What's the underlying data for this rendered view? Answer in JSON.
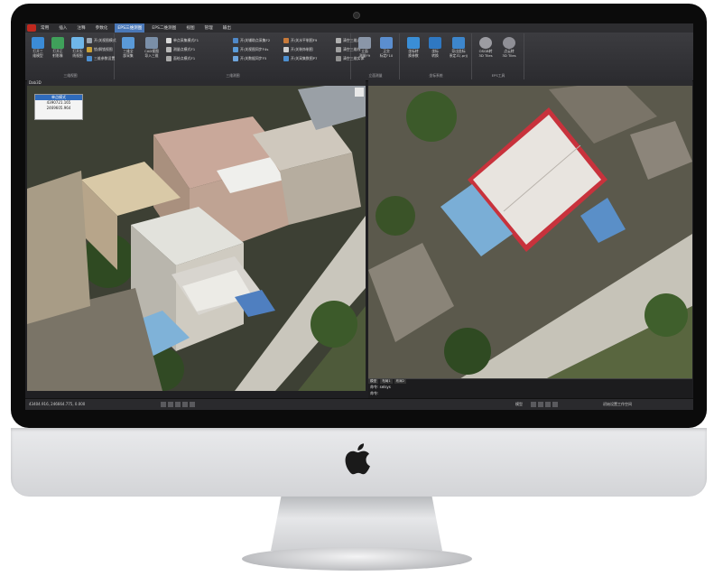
{
  "app": {
    "menu_tabs": [
      "常用",
      "插入",
      "注释",
      "参数化",
      "EPS三维测图",
      "EPS二维测图",
      "视图",
      "管理",
      "输出"
    ],
    "active_tab_index": 4,
    "viewport_label": "Dab3D"
  },
  "ribbon": {
    "group1": {
      "label": "三维视图",
      "big": [
        {
          "label": "打开三\n维模型",
          "color": "#3b8bd6"
        },
        {
          "label": "打开正\n射影像",
          "color": "#3fa05a"
        },
        {
          "label": "打开实\n线视图",
          "color": "#6fb6e8"
        }
      ],
      "small": [
        "开/关视图模式",
        "锁/解锁视图",
        "三维参数设置"
      ]
    },
    "group2": {
      "label": "三维测图",
      "big": [
        {
          "label": "三维全\n部采集",
          "color": "#5a9ad8"
        },
        {
          "label": "CAD视图\n导入三维",
          "color": "#7a8fa8"
        }
      ],
      "small": [
        "单点采集模式F1",
        "测量点模式F1",
        "面绘点模式F1",
        "开/关辅助点采集F2",
        "开/关视图同步F4s",
        "开/关数据同步F5",
        "开/关水平制图F9",
        "开/关装饰制图",
        "开/关采集数图P7",
        "清空三维点",
        "清空三维线",
        "清空三维实体"
      ]
    },
    "group3": {
      "label": "立面测量",
      "big": [
        {
          "label": "立面\n测量F9",
          "color": "#8a96a8"
        },
        {
          "label": "正交\n标定F10",
          "color": "#5b8ecf"
        }
      ]
    },
    "group4": {
      "label": "坐标系统",
      "big": [
        {
          "label": "坐标转\n换参数",
          "color": "#3a8ed6"
        },
        {
          "label": "坐标\n转换",
          "color": "#2f78c2"
        },
        {
          "label": "导出坐标\n系定义(.prj)",
          "color": "#3d86cc"
        }
      ]
    },
    "group5": {
      "label": "EPS工具",
      "big": [
        {
          "label": "OSGB转\n3D Tiles",
          "color": "#9c9ca2"
        },
        {
          "label": "点云转\n3D Tiles",
          "color": "#8f8f96"
        }
      ]
    }
  },
  "infobox": {
    "title": "单点模式",
    "x": "4390721.165",
    "y": "2469605.964"
  },
  "command": {
    "tabs": [
      "模型",
      "布局1",
      "布局2"
    ],
    "line1": "命令: selsys",
    "line2": "命令:"
  },
  "status": {
    "coords": "43404.916, 246664.775, 0.000",
    "model_label": "模型",
    "workspace": "初始设置工作空间"
  }
}
